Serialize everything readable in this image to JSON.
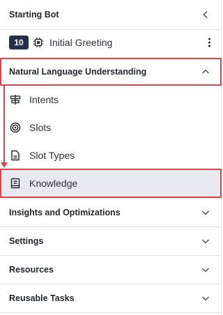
{
  "header": {
    "title": "Starting Bot"
  },
  "greeting": {
    "badge": "10",
    "label": "Initial Greeting"
  },
  "nlu": {
    "title": "Natural Language Understanding",
    "items": [
      {
        "label": "Intents",
        "icon": "intents-icon"
      },
      {
        "label": "Slots",
        "icon": "target-icon"
      },
      {
        "label": "Slot Types",
        "icon": "document-icon"
      },
      {
        "label": "Knowledge",
        "icon": "book-icon",
        "selected": true
      }
    ]
  },
  "sections": [
    {
      "title": "Insights and Optimizations"
    },
    {
      "title": "Settings"
    },
    {
      "title": "Resources"
    },
    {
      "title": "Reusable Tasks"
    }
  ],
  "colors": {
    "highlight": "#e0424a",
    "selected_bg": "#e8eaf0",
    "badge_bg": "#23304a"
  }
}
